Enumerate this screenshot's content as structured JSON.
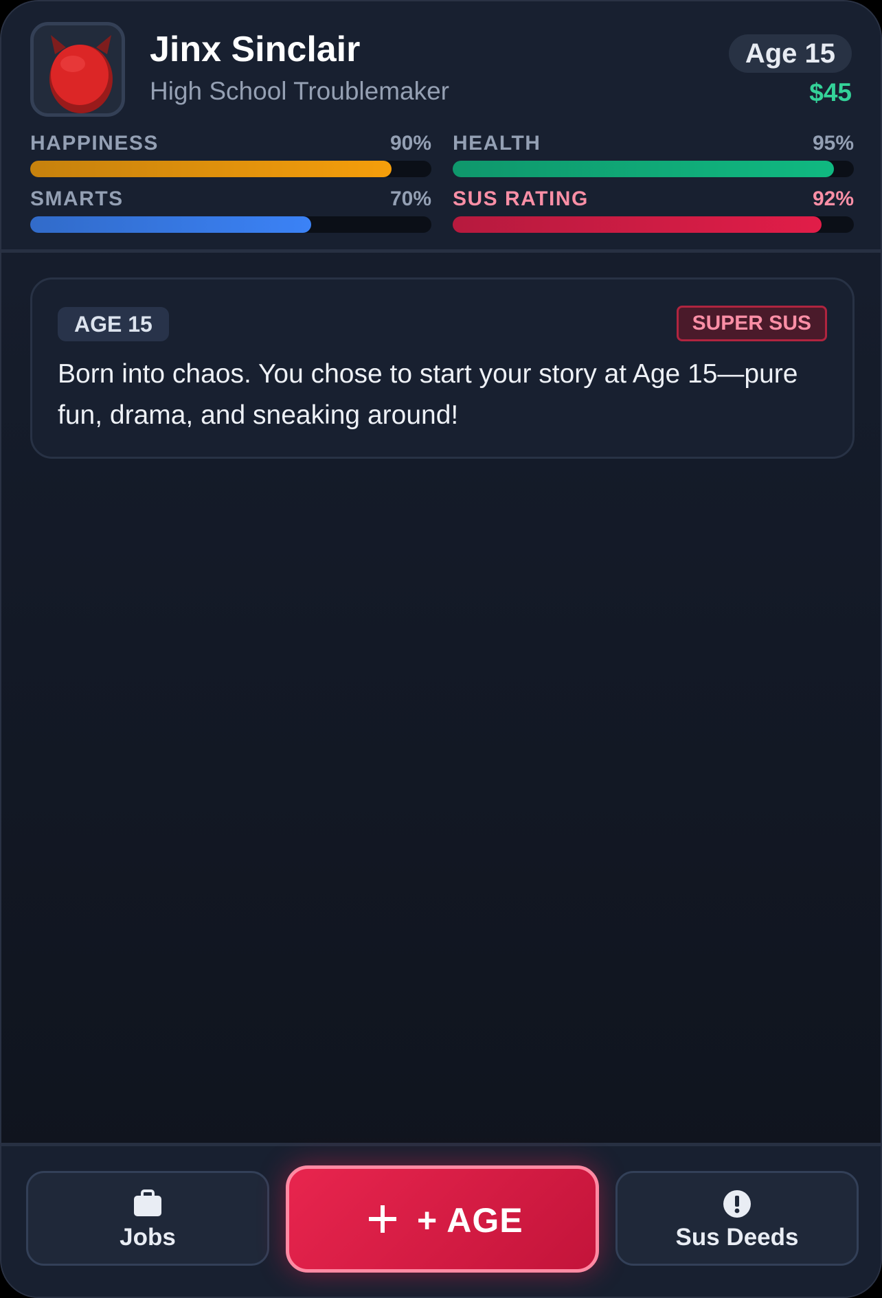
{
  "profile": {
    "name": "Jinx Sinclair",
    "subtitle": "High School Troublemaker",
    "age_label": "Age 15",
    "money": "$45",
    "avatar_icon": "devil-face-icon"
  },
  "stats": [
    {
      "label": "HAPPINESS",
      "value": "90%",
      "level": 0.9,
      "color": "#f59e0b"
    },
    {
      "label": "HEALTH",
      "value": "95%",
      "level": 0.95,
      "color": "#10b981"
    },
    {
      "label": "SMARTS",
      "value": "70%",
      "level": 0.7,
      "color": "#3b82f6"
    },
    {
      "label": "SUS RATING",
      "value": "92%",
      "level": 0.92,
      "color": "#e11d48"
    }
  ],
  "event_card": {
    "age_tag": "AGE 15",
    "badge": "SUPER SUS",
    "text": "Born into chaos. You chose to start your story at Age 15—pure fun, drama, and sneaking around!"
  },
  "nav": {
    "jobs_label": "Jobs",
    "jobs_icon": "briefcase-icon",
    "age_button_label": "+ AGE",
    "age_icon": "plus-icon",
    "deeds_label": "Sus Deeds",
    "deeds_icon": "exclamation-circle-icon"
  }
}
